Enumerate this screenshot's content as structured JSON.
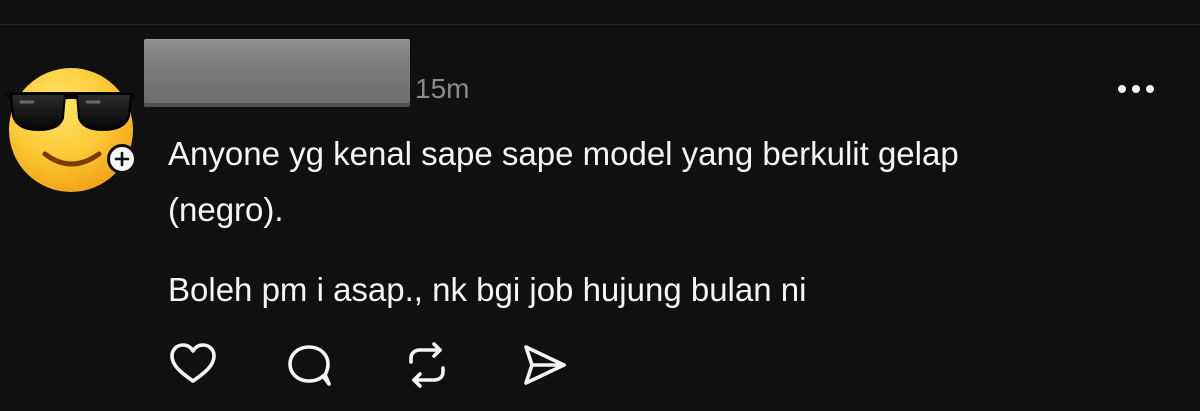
{
  "post": {
    "author_avatar": "sunglasses-emoji-avatar",
    "author_name_redacted": true,
    "timestamp": "15m",
    "lines": [
      "Anyone yg kenal sape sape model yang berkulit gelap",
      "(negro).",
      "Boleh pm i asap., nk bgi job hujung bulan ni"
    ]
  },
  "icons": {
    "more": "more-icon",
    "like": "heart-icon",
    "reply": "comment-icon",
    "repost": "repost-icon",
    "share": "send-icon",
    "follow": "plus-icon"
  },
  "colors": {
    "background": "#101010",
    "text": "#f3f5f7",
    "secondary_text": "#8a8a8a",
    "icon": "#f3f5f7",
    "redaction": "#7f7f7f"
  }
}
